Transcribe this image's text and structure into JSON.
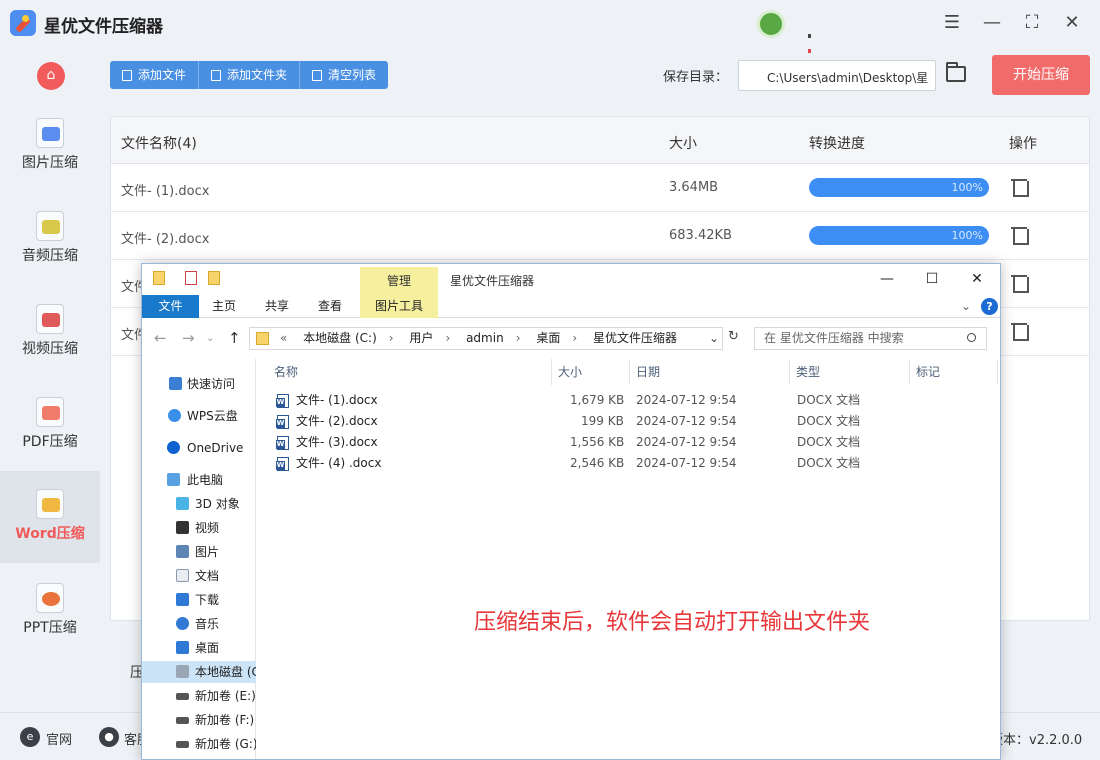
{
  "app": {
    "title": "星优文件压缩器",
    "version": "版本：v2.2.0.0"
  },
  "sidebar": {
    "items": [
      {
        "label": "图片压缩",
        "icon": "image-compress-icon",
        "color": "#5b8def"
      },
      {
        "label": "音频压缩",
        "icon": "audio-compress-icon",
        "color": "#d9c94a"
      },
      {
        "label": "视频压缩",
        "icon": "video-compress-icon",
        "color": "#e05a5a"
      },
      {
        "label": "PDF压缩",
        "icon": "pdf-compress-icon",
        "color": "#f07d6b"
      },
      {
        "label": "Word压缩",
        "icon": "word-compress-icon",
        "color": "#f0b840"
      },
      {
        "label": "PPT压缩",
        "icon": "ppt-compress-icon",
        "color": "#e8733b"
      }
    ]
  },
  "toolbar": {
    "add_file": "添加文件",
    "add_folder": "添加文件夹",
    "clear_list": "清空列表",
    "save_dir_label": "保存目录：",
    "save_dir_value": "C:\\Users\\admin\\Desktop\\星",
    "start_button": "开始压缩"
  },
  "table": {
    "headers": {
      "name": "文件名称(4)",
      "size": "大小",
      "progress": "转换进度",
      "action": "操作"
    },
    "rows": [
      {
        "name": "文件- (1).docx",
        "size": "3.64MB",
        "progress": "100%",
        "progress_value": 1.0
      },
      {
        "name": "文件- (2).docx",
        "size": "683.42KB",
        "progress": "100%",
        "progress_value": 1.0
      },
      {
        "name": "文件",
        "size": "",
        "progress": "",
        "progress_value": null
      },
      {
        "name": "文件",
        "size": "",
        "progress": "",
        "progress_value": null
      }
    ]
  },
  "footer": {
    "website": "官网",
    "service": "客服",
    "compress_label": "压"
  },
  "explorer": {
    "title": "星优文件压缩器",
    "manage_tab": "管理",
    "ribbon_tabs": [
      "文件",
      "主页",
      "共享",
      "查看",
      "图片工具"
    ],
    "address": [
      "本地磁盘 (C:)",
      "用户",
      "admin",
      "桌面",
      "星优文件压缩器"
    ],
    "search_placeholder": "在 星优文件压缩器 中搜索",
    "nav_pane": [
      {
        "label": "快速访问",
        "icon": "star-icon"
      },
      {
        "label": "WPS云盘",
        "icon": "cloud-icon"
      },
      {
        "label": "OneDrive",
        "icon": "onedrive-icon"
      },
      {
        "label": "此电脑",
        "icon": "computer-icon"
      },
      {
        "label": "3D 对象",
        "icon": "cube-icon"
      },
      {
        "label": "视频",
        "icon": "video-folder-icon"
      },
      {
        "label": "图片",
        "icon": "picture-folder-icon"
      },
      {
        "label": "文档",
        "icon": "document-folder-icon"
      },
      {
        "label": "下载",
        "icon": "download-icon"
      },
      {
        "label": "音乐",
        "icon": "music-icon"
      },
      {
        "label": "桌面",
        "icon": "desktop-icon"
      },
      {
        "label": "本地磁盘 (C",
        "icon": "drive-c-icon"
      },
      {
        "label": "新加卷 (E:)",
        "icon": "drive-icon"
      },
      {
        "label": "新加卷 (F:)",
        "icon": "drive-icon"
      },
      {
        "label": "新加卷 (G:)",
        "icon": "drive-icon"
      }
    ],
    "columns": {
      "name": "名称",
      "size": "大小",
      "date": "日期",
      "type": "类型",
      "tags": "标记"
    },
    "files": [
      {
        "name": "文件- (1).docx",
        "size": "1,679 KB",
        "date": "2024-07-12 9:54",
        "type": "DOCX 文档"
      },
      {
        "name": "文件- (2).docx",
        "size": "199 KB",
        "date": "2024-07-12 9:54",
        "type": "DOCX 文档"
      },
      {
        "name": "文件- (3).docx",
        "size": "1,556 KB",
        "date": "2024-07-12 9:54",
        "type": "DOCX 文档"
      },
      {
        "name": "文件- (4) .docx",
        "size": "2,546 KB",
        "date": "2024-07-12 9:54",
        "type": "DOCX 文档"
      }
    ],
    "overlay_note": "压缩结束后，软件会自动打开输出文件夹"
  }
}
